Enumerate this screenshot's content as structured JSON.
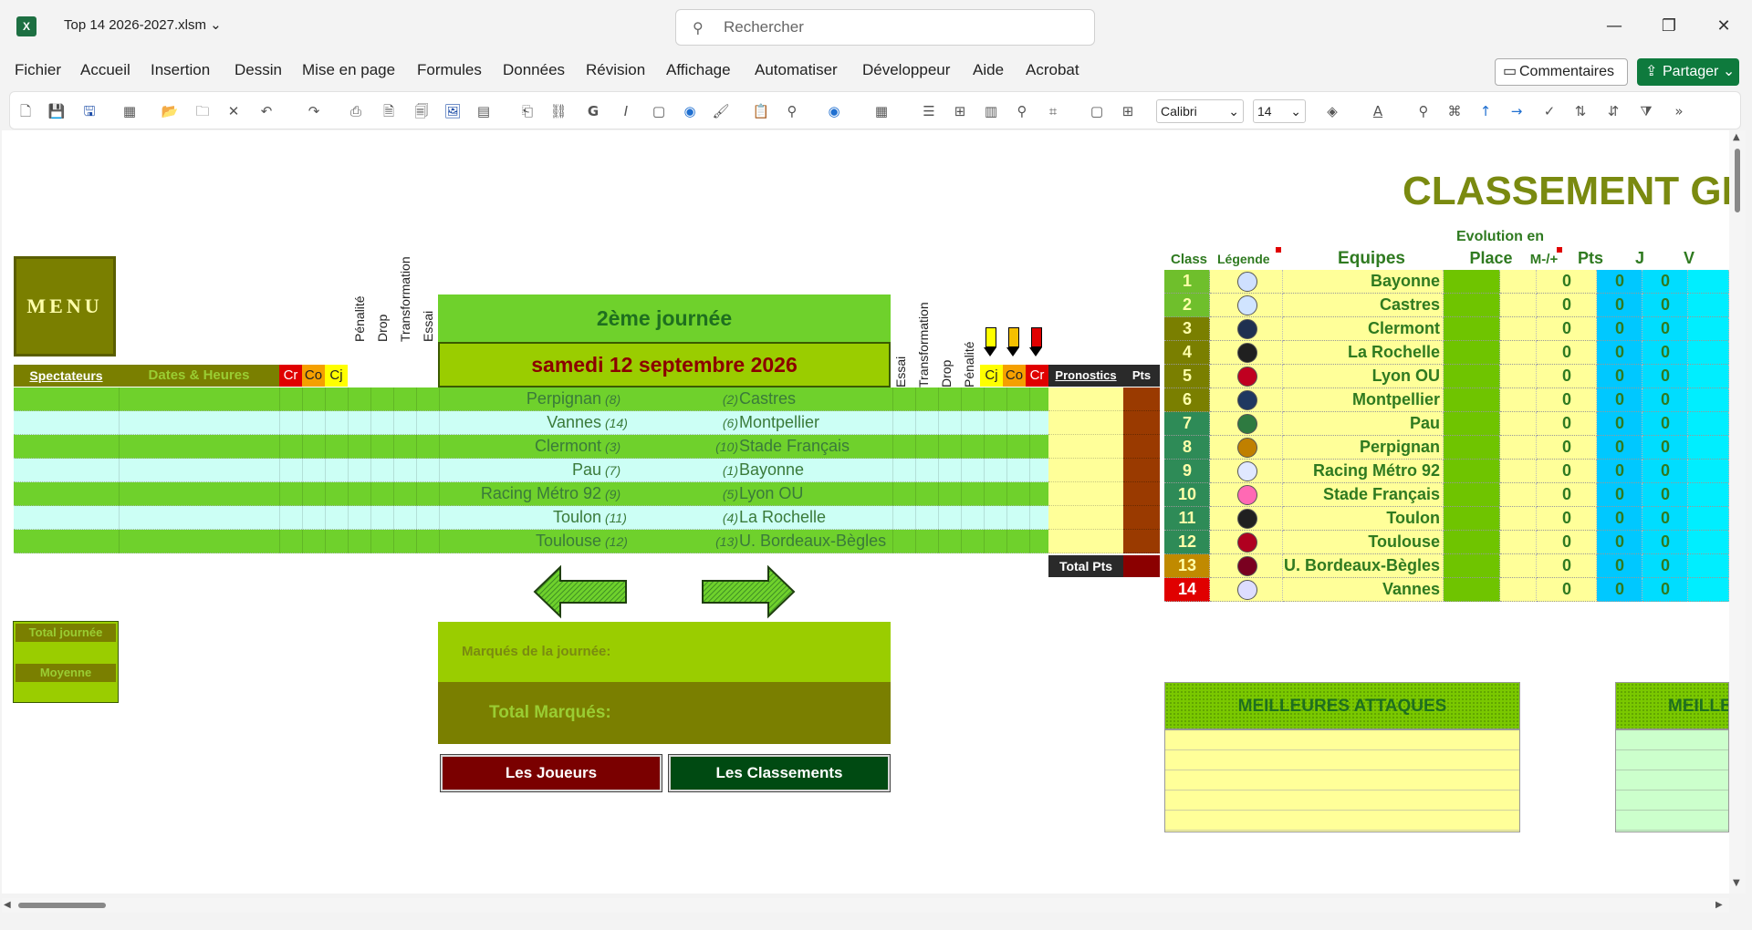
{
  "window": {
    "filename": "Top 14 2026-2027.xlsm",
    "search_placeholder": "Rechercher",
    "excel_letter": "X"
  },
  "menu": {
    "items": [
      "Fichier",
      "Accueil",
      "Insertion",
      "Dessin",
      "Mise en page",
      "Formules",
      "Données",
      "Révision",
      "Affichage",
      "Automatiser",
      "Développeur",
      "Aide",
      "Acrobat"
    ],
    "comment_label": "Commentaires",
    "share_label": "Partager"
  },
  "toolbar": {
    "font_name": "Calibri",
    "font_size": "14"
  },
  "sheet": {
    "title": "CLASSEMENT GE",
    "menu_button": "MENU",
    "journee": "2ème journée",
    "date": "samedi 12 septembre 2026",
    "headers": {
      "spectateurs": "Spectateurs",
      "dates": "Dates & Heures",
      "cr": "Cr",
      "co": "Co",
      "cj": "Cj",
      "penalite": "Pénalité",
      "drop": "Drop",
      "transformation": "Transformation",
      "essai": "Essai",
      "pronostics": "Pronostics",
      "pts": "Pts",
      "total_pts": "Total Pts"
    },
    "matches": [
      {
        "home": "Perpignan",
        "home_rank": "(8)",
        "away_rank": "(2)",
        "away": "Castres"
      },
      {
        "home": "Vannes",
        "home_rank": "(14)",
        "away_rank": "(6)",
        "away": "Montpellier"
      },
      {
        "home": "Clermont",
        "home_rank": "(3)",
        "away_rank": "(10)",
        "away": "Stade Français"
      },
      {
        "home": "Pau",
        "home_rank": "(7)",
        "away_rank": "(1)",
        "away": "Bayonne"
      },
      {
        "home": "Racing Métro 92",
        "home_rank": "(9)",
        "away_rank": "(5)",
        "away": "Lyon OU"
      },
      {
        "home": "Toulon",
        "home_rank": "(11)",
        "away_rank": "(4)",
        "away": "La Rochelle"
      },
      {
        "home": "Toulouse",
        "home_rank": "(12)",
        "away_rank": "(13)",
        "away": "U. Bordeaux-Bègles"
      }
    ],
    "total_journee": "Total journée",
    "moyenne": "Moyenne",
    "marques_journee": "Marqués de la journée:",
    "total_marques": "Total Marqués:",
    "btn_joueurs": "Les Joueurs",
    "btn_classements": "Les Classements",
    "standings_headers": {
      "class": "Class",
      "legende": "Légende",
      "equipes": "Equipes",
      "evolution": "Evolution en",
      "place": "Place",
      "mplus": "M-/+",
      "pts": "Pts",
      "j": "J",
      "v": "V"
    },
    "standings": [
      {
        "rank": "1",
        "team": "Bayonne",
        "pts": "0",
        "j": "0",
        "v": "0"
      },
      {
        "rank": "2",
        "team": "Castres",
        "pts": "0",
        "j": "0",
        "v": "0"
      },
      {
        "rank": "3",
        "team": "Clermont",
        "pts": "0",
        "j": "0",
        "v": "0"
      },
      {
        "rank": "4",
        "team": "La Rochelle",
        "pts": "0",
        "j": "0",
        "v": "0"
      },
      {
        "rank": "5",
        "team": "Lyon OU",
        "pts": "0",
        "j": "0",
        "v": "0"
      },
      {
        "rank": "6",
        "team": "Montpellier",
        "pts": "0",
        "j": "0",
        "v": "0"
      },
      {
        "rank": "7",
        "team": "Pau",
        "pts": "0",
        "j": "0",
        "v": "0"
      },
      {
        "rank": "8",
        "team": "Perpignan",
        "pts": "0",
        "j": "0",
        "v": "0"
      },
      {
        "rank": "9",
        "team": "Racing Métro 92",
        "pts": "0",
        "j": "0",
        "v": "0"
      },
      {
        "rank": "10",
        "team": "Stade Français",
        "pts": "0",
        "j": "0",
        "v": "0"
      },
      {
        "rank": "11",
        "team": "Toulon",
        "pts": "0",
        "j": "0",
        "v": "0"
      },
      {
        "rank": "12",
        "team": "Toulouse",
        "pts": "0",
        "j": "0",
        "v": "0"
      },
      {
        "rank": "13",
        "team": "U. Bordeaux-Bègles",
        "pts": "0",
        "j": "0",
        "v": "0"
      },
      {
        "rank": "14",
        "team": "Vannes",
        "pts": "0",
        "j": "0",
        "v": "0"
      }
    ],
    "rank_colors": [
      "#6fbf2c",
      "#6fbf2c",
      "#7a7f00",
      "#7a7f00",
      "#7a7f00",
      "#7a7f00",
      "#2e8b57",
      "#2e8b57",
      "#2e8b57",
      "#2e8b57",
      "#2e8b57",
      "#2e8b57",
      "#c08a00",
      "#e00000"
    ],
    "meilleures_attaques": "MEILLEURES ATTAQUES",
    "meilleures_defenses": "MEILLE"
  }
}
